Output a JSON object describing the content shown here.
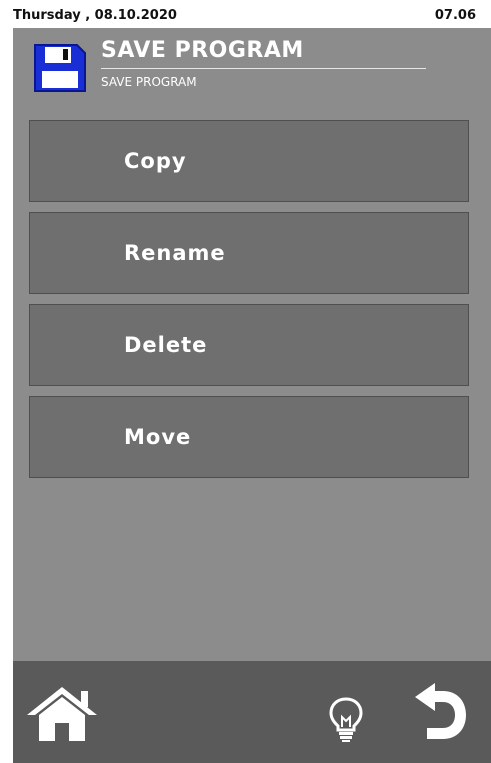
{
  "status": {
    "date": "Thursday , 08.10.2020",
    "time": "07.06"
  },
  "header": {
    "icon": "floppy-disk-icon",
    "title": "SAVE PROGRAM",
    "subtitle": "SAVE PROGRAM"
  },
  "menu": {
    "items": [
      {
        "label": "Copy"
      },
      {
        "label": "Rename"
      },
      {
        "label": "Delete"
      },
      {
        "label": "Move"
      }
    ]
  },
  "footer": {
    "home_icon": "home-icon",
    "help_icon": "lightbulb-icon",
    "back_icon": "back-arrow-icon"
  },
  "colors": {
    "screen_bg": "#8c8c8c",
    "button_bg": "#6f6f6f",
    "footer_bg": "#5a5a5a",
    "icon_blue": "#1a2ed6"
  }
}
